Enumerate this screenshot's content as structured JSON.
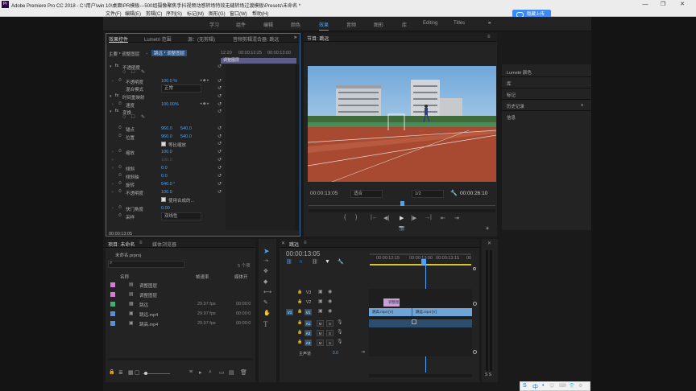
{
  "window": {
    "title": "Adobe Premiere Pro CC 2018 - C:\\用户\\win 10\\桌面\\PR模板---500组摄像聚焦手抖视频动感转场特效无缝转场过渡模板\\Presets\\未命名 *",
    "logo": "Pr",
    "minimize": "—",
    "maximize": "❐",
    "close": "✕"
  },
  "menu": [
    "文件(F)",
    "编辑(E)",
    "剪辑(C)",
    "序列(S)",
    "标记(M)",
    "图形(G)",
    "窗口(W)",
    "帮助(H)"
  ],
  "upload_button": "隐藏上传",
  "workspaces": [
    "学习",
    "组件",
    "编辑",
    "颜色",
    "效果",
    "音频",
    "图形",
    "库",
    "Editing",
    "Titles"
  ],
  "workspaces_more": "»",
  "effect_controls": {
    "tabs": [
      "效果控件",
      "Lumetri 范围",
      "源：(无剪辑)",
      "音频剪辑混合器: 跳远"
    ],
    "tabs_more": "»",
    "master_label": "主要 * 调整图层",
    "clip_label": "跳远 * 调整图层",
    "ruler_times": [
      "12:20",
      "00:00:12:25",
      "00:00:13:00"
    ],
    "clip_chip": "调整图层",
    "timecode": "00:00:13:05",
    "props": [
      {
        "name": "不透明度",
        "value": "",
        "fx": true
      },
      {
        "name": "不透明度",
        "value": "100.0 %"
      },
      {
        "name": "混合模式",
        "value": "正常"
      },
      {
        "name": "时间重映射",
        "value": "",
        "fx": true
      },
      {
        "name": "速度",
        "value": "100.00%"
      },
      {
        "name": "变换",
        "value": "",
        "fx": true
      },
      {
        "name": "锚点",
        "value": "960.0",
        "value2": "540.0"
      },
      {
        "name": "位置",
        "value": "960.0",
        "value2": "540.0"
      },
      {
        "name": "等比缩放",
        "value": ""
      },
      {
        "name": "缩放",
        "value": "100.0"
      },
      {
        "name": "",
        "value": "100.0"
      },
      {
        "name": "倾斜",
        "value": "0.0"
      },
      {
        "name": "倾斜轴",
        "value": "0.0"
      },
      {
        "name": "旋转",
        "value": "540.0 °"
      },
      {
        "name": "不透明度",
        "value": "100.0"
      },
      {
        "name": "使用合成的...",
        "value": ""
      },
      {
        "name": "快门角度",
        "value": "0.00"
      },
      {
        "name": "采样",
        "value": "双线性"
      }
    ]
  },
  "program": {
    "tab": "节目: 跳远",
    "timecode_left": "00:00:13:05",
    "fit": "适合",
    "quality": "1/2",
    "timecode_right": "00:00:26:10",
    "transport": [
      "{",
      "}",
      "|←",
      "◀|",
      "▶",
      "|▶",
      "→|",
      "⇤",
      "⇥",
      "📷",
      "+"
    ]
  },
  "right_panel": {
    "items": [
      "Lumetri 颜色",
      "库",
      "标记",
      "历史记录",
      "信息"
    ]
  },
  "project": {
    "tabs": [
      "项目: 未命名",
      "媒体浏览器"
    ],
    "file": "未命名.prproj",
    "count": "5 个项",
    "search_placeholder": "",
    "columns": [
      "名称",
      "帧速率",
      "媒体开"
    ],
    "items": [
      {
        "name": "调整图层",
        "fps": "",
        "start": "",
        "color": "#d67bd4"
      },
      {
        "name": "调整图层",
        "fps": "",
        "start": "",
        "color": "#d67bd4"
      },
      {
        "name": "跳远",
        "fps": "29.97 fps",
        "start": "00:00:0",
        "color": "#3cb371"
      },
      {
        "name": "跳远.mp4",
        "fps": "29.97 fps",
        "start": "00:00:0",
        "color": "#5a8fd8"
      },
      {
        "name": "跳高.mp4",
        "fps": "29.97 fps",
        "start": "00:00:0",
        "color": "#5a8fd8"
      }
    ]
  },
  "timeline": {
    "tab": "跳远",
    "timecode": "00:00:13:05",
    "ruler": [
      "00:00:12:15",
      "00:00:13:00",
      "00:00:13:15",
      "00"
    ],
    "tracks": [
      "V3",
      "V2",
      "V1",
      "A1",
      "A2",
      "A3",
      "主声道"
    ],
    "master_value": "0.0",
    "clip_adj": "调整图",
    "clip_v1a": "跳高.mp4 [V]",
    "clip_v1b": "跳远.mp4 [V]",
    "source_patch": "V1",
    "meter_label": "S S"
  },
  "taskbar": [
    "S",
    "中",
    "•",
    "😊",
    "⌨",
    "👕",
    "⚙"
  ]
}
